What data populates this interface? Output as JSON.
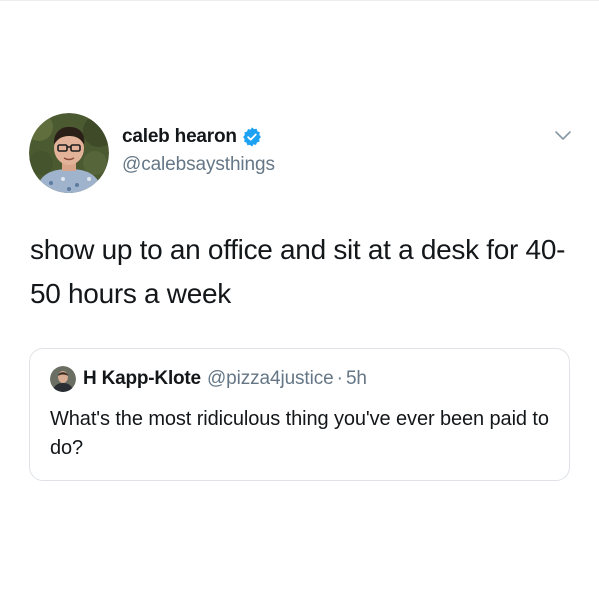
{
  "tweet": {
    "author": {
      "display_name": "caleb hearon",
      "handle": "@calebsaysthings",
      "verified": true,
      "avatar_icon": "profile-photo"
    },
    "menu_icon": "chevron-down-icon",
    "text": "show up to an office and sit at a desk for 40-50 hours a week"
  },
  "quoted_tweet": {
    "author": {
      "display_name": "H Kapp-Klote",
      "handle": "@pizza4justice",
      "avatar_icon": "profile-photo"
    },
    "separator": "·",
    "time": "5h",
    "text": "What's the most ridiculous thing you've ever been paid to do?"
  },
  "colors": {
    "text": "#14171a",
    "secondary": "#657786",
    "verified": "#1da1f2",
    "border": "#dfe3e7"
  }
}
